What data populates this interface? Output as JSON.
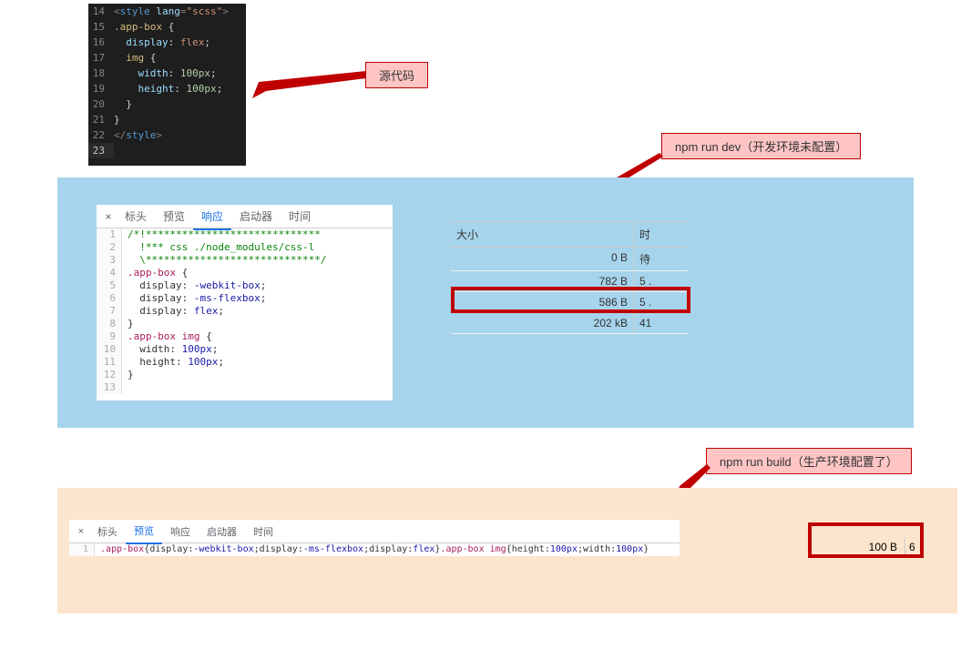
{
  "editor": {
    "lines": [
      {
        "num": "14",
        "tokens": [
          [
            "c-tag",
            "<"
          ],
          [
            "c-name",
            "style"
          ],
          [
            "c-tag",
            " "
          ],
          [
            "c-attr",
            "lang"
          ],
          [
            "c-tag",
            "="
          ],
          [
            "c-str",
            "\"scss\""
          ],
          [
            "c-tag",
            ">"
          ]
        ]
      },
      {
        "num": "15",
        "tokens": [
          [
            "c-sel",
            ".app-box "
          ],
          [
            "c-brace",
            "{"
          ]
        ]
      },
      {
        "num": "16",
        "tokens": [
          [
            "",
            "  "
          ],
          [
            "c-prop",
            "display"
          ],
          [
            "c-brace",
            ": "
          ],
          [
            "c-val",
            "flex"
          ],
          [
            "c-brace",
            ";"
          ]
        ]
      },
      {
        "num": "17",
        "tokens": [
          [
            "",
            "  "
          ],
          [
            "c-sel",
            "img "
          ],
          [
            "c-brace",
            "{"
          ]
        ]
      },
      {
        "num": "18",
        "tokens": [
          [
            "",
            "    "
          ],
          [
            "c-prop",
            "width"
          ],
          [
            "c-brace",
            ": "
          ],
          [
            "c-num",
            "100px"
          ],
          [
            "c-brace",
            ";"
          ]
        ]
      },
      {
        "num": "19",
        "tokens": [
          [
            "",
            "    "
          ],
          [
            "c-prop",
            "height"
          ],
          [
            "c-brace",
            ": "
          ],
          [
            "c-num",
            "100px"
          ],
          [
            "c-brace",
            ";"
          ]
        ]
      },
      {
        "num": "20",
        "tokens": [
          [
            "",
            "  "
          ],
          [
            "c-brace",
            "}"
          ]
        ]
      },
      {
        "num": "21",
        "tokens": [
          [
            "c-brace",
            "}"
          ]
        ]
      },
      {
        "num": "22",
        "tokens": [
          [
            "c-tag",
            "</"
          ],
          [
            "c-name",
            "style"
          ],
          [
            "c-tag",
            ">"
          ]
        ]
      },
      {
        "num": "23",
        "tokens": [],
        "active": true
      }
    ]
  },
  "callouts": {
    "source": "源代码",
    "dev": "npm run dev（开发环境未配置）",
    "build": "npm run build（生产环境配置了）"
  },
  "devtabs": {
    "close": "×",
    "t1": "标头",
    "t2": "预览",
    "t3": "响应",
    "t4": "启动器",
    "t5": "时间"
  },
  "devcode1": [
    {
      "n": "1",
      "t": [
        [
          "lc-comment",
          "/*!*****************************"
        ]
      ]
    },
    {
      "n": "2",
      "t": [
        [
          "lc-comment",
          "  !*** css ./node_modules/css-l"
        ]
      ]
    },
    {
      "n": "3",
      "t": [
        [
          "lc-comment",
          "  \\*****************************/"
        ]
      ]
    },
    {
      "n": "4",
      "t": [
        [
          "lc-sel",
          ".app-box "
        ],
        [
          "",
          "{"
        ]
      ]
    },
    {
      "n": "5",
      "t": [
        [
          "",
          "  "
        ],
        [
          "lc-prop",
          "display"
        ],
        [
          "",
          ": "
        ],
        [
          "lc-val",
          "-webkit-box"
        ],
        [
          "",
          ";"
        ]
      ]
    },
    {
      "n": "6",
      "t": [
        [
          "",
          "  "
        ],
        [
          "lc-prop",
          "display"
        ],
        [
          "",
          ": "
        ],
        [
          "lc-val",
          "-ms-flexbox"
        ],
        [
          "",
          ";"
        ]
      ]
    },
    {
      "n": "7",
      "t": [
        [
          "",
          "  "
        ],
        [
          "lc-prop",
          "display"
        ],
        [
          "",
          ": "
        ],
        [
          "lc-val",
          "flex"
        ],
        [
          "",
          ";"
        ]
      ]
    },
    {
      "n": "8",
      "t": [
        [
          "",
          "}"
        ]
      ]
    },
    {
      "n": "9",
      "t": [
        [
          "lc-sel",
          ".app-box img "
        ],
        [
          "",
          "{"
        ]
      ]
    },
    {
      "n": "10",
      "t": [
        [
          "",
          "  "
        ],
        [
          "lc-prop",
          "width"
        ],
        [
          "",
          ": "
        ],
        [
          "lc-num",
          "100px"
        ],
        [
          "",
          ";"
        ]
      ]
    },
    {
      "n": "11",
      "t": [
        [
          "",
          "  "
        ],
        [
          "lc-prop",
          "height"
        ],
        [
          "",
          ": "
        ],
        [
          "lc-num",
          "100px"
        ],
        [
          "",
          ";"
        ]
      ]
    },
    {
      "n": "12",
      "t": [
        [
          "",
          "}"
        ]
      ]
    },
    {
      "n": "13",
      "t": []
    }
  ],
  "net1": {
    "hsize": "大小",
    "htime": "时",
    "rows": [
      {
        "size": "0 B",
        "time": "待"
      },
      {
        "size": "782 B",
        "time": "5 ."
      },
      {
        "size": "586 B",
        "time": "5 ."
      },
      {
        "size": "202 kB",
        "time": "41"
      }
    ]
  },
  "devcode2": {
    "n": "1",
    "t": [
      [
        "lc-sel",
        ".app-box"
      ],
      [
        "",
        "{"
      ],
      [
        "lc-prop",
        "display"
      ],
      [
        "",
        ":"
      ],
      [
        "lc-val",
        "-webkit-box"
      ],
      [
        "",
        ";"
      ],
      [
        "lc-prop",
        "display"
      ],
      [
        "",
        ":"
      ],
      [
        "lc-val",
        "-ms-flexbox"
      ],
      [
        "",
        ";"
      ],
      [
        "lc-prop",
        "display"
      ],
      [
        "",
        ":"
      ],
      [
        "lc-val",
        "flex"
      ],
      [
        "",
        "}"
      ],
      [
        "lc-sel",
        ".app-box img"
      ],
      [
        "",
        "{"
      ],
      [
        "lc-prop",
        "height"
      ],
      [
        "",
        ":"
      ],
      [
        "lc-num",
        "100px"
      ],
      [
        "",
        ";"
      ],
      [
        "lc-prop",
        "width"
      ],
      [
        "",
        ":"
      ],
      [
        "lc-num",
        "100px"
      ],
      [
        "",
        "}"
      ]
    ]
  },
  "net2": {
    "size": "100 B",
    "time": "6"
  }
}
